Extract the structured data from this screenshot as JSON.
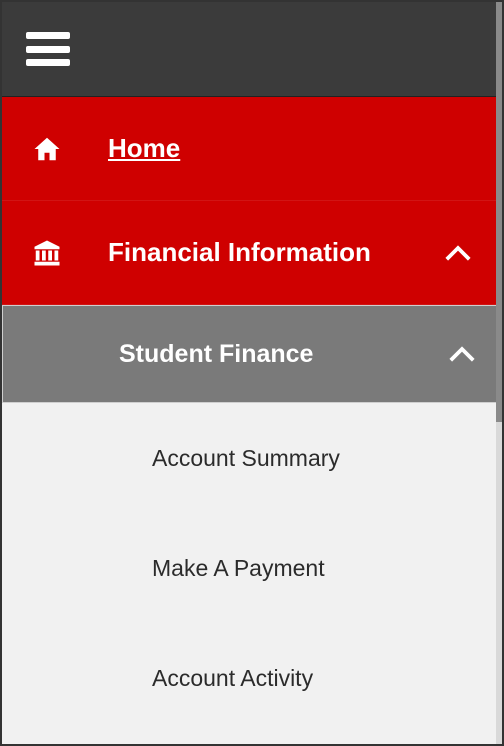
{
  "nav": {
    "home_label": "Home",
    "financial_label": "Financial Information"
  },
  "submenu": {
    "header_label": "Student Finance",
    "items": [
      "Account Summary",
      "Make A Payment",
      "Account Activity"
    ]
  }
}
